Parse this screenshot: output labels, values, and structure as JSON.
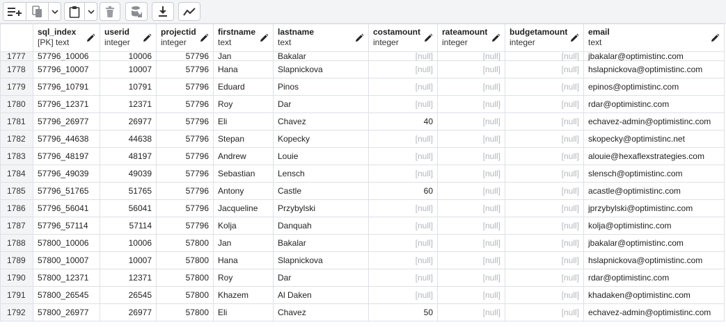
{
  "toolbar": {
    "buttons": [
      {
        "name": "add-row-icon"
      },
      {
        "name": "copy-icon"
      },
      {
        "name": "copy-options-chevron-icon"
      },
      {
        "name": "paste-icon"
      },
      {
        "name": "paste-options-chevron-icon"
      },
      {
        "name": "delete-icon"
      },
      {
        "name": "save-data-icon"
      },
      {
        "name": "download-icon"
      },
      {
        "name": "graph-visualiser-icon"
      }
    ]
  },
  "columns": [
    {
      "name": "sql_index",
      "type": "[PK] text"
    },
    {
      "name": "userid",
      "type": "integer"
    },
    {
      "name": "projectid",
      "type": "integer"
    },
    {
      "name": "firstname",
      "type": "text"
    },
    {
      "name": "lastname",
      "type": "text"
    },
    {
      "name": "costamount",
      "type": "integer"
    },
    {
      "name": "rateamount",
      "type": "integer"
    },
    {
      "name": "budgetamount",
      "type": "integer"
    },
    {
      "name": "email",
      "type": "text"
    }
  ],
  "null_label": "[null]",
  "rows": [
    {
      "rn": "1777",
      "sql_index": "57796_10006",
      "userid": "10006",
      "projectid": "57796",
      "firstname": "Jan",
      "lastname": "Bakalar",
      "costamount": null,
      "rateamount": null,
      "budgetamount": null,
      "email": "jbakalar@optimistinc.com"
    },
    {
      "rn": "1778",
      "sql_index": "57796_10007",
      "userid": "10007",
      "projectid": "57796",
      "firstname": "Hana",
      "lastname": "Slapnickova",
      "costamount": null,
      "rateamount": null,
      "budgetamount": null,
      "email": "hslapnickova@optimistinc.com"
    },
    {
      "rn": "1779",
      "sql_index": "57796_10791",
      "userid": "10791",
      "projectid": "57796",
      "firstname": "Eduard",
      "lastname": "Pinos",
      "costamount": null,
      "rateamount": null,
      "budgetamount": null,
      "email": "epinos@optimistinc.com"
    },
    {
      "rn": "1780",
      "sql_index": "57796_12371",
      "userid": "12371",
      "projectid": "57796",
      "firstname": "Roy",
      "lastname": "Dar",
      "costamount": null,
      "rateamount": null,
      "budgetamount": null,
      "email": "rdar@optimistinc.com"
    },
    {
      "rn": "1781",
      "sql_index": "57796_26977",
      "userid": "26977",
      "projectid": "57796",
      "firstname": "Eli",
      "lastname": "Chavez",
      "costamount": "40",
      "rateamount": null,
      "budgetamount": null,
      "email": "echavez-admin@optimistinc.com"
    },
    {
      "rn": "1782",
      "sql_index": "57796_44638",
      "userid": "44638",
      "projectid": "57796",
      "firstname": "Stepan",
      "lastname": "Kopecky",
      "costamount": null,
      "rateamount": null,
      "budgetamount": null,
      "email": "skopecky@optimistinc.net"
    },
    {
      "rn": "1783",
      "sql_index": "57796_48197",
      "userid": "48197",
      "projectid": "57796",
      "firstname": "Andrew",
      "lastname": "Louie",
      "costamount": null,
      "rateamount": null,
      "budgetamount": null,
      "email": "alouie@hexaflexstrategies.com"
    },
    {
      "rn": "1784",
      "sql_index": "57796_49039",
      "userid": "49039",
      "projectid": "57796",
      "firstname": "Sebastian",
      "lastname": "Lensch",
      "costamount": null,
      "rateamount": null,
      "budgetamount": null,
      "email": "slensch@optimistinc.com"
    },
    {
      "rn": "1785",
      "sql_index": "57796_51765",
      "userid": "51765",
      "projectid": "57796",
      "firstname": "Antony",
      "lastname": "Castle",
      "costamount": "60",
      "rateamount": null,
      "budgetamount": null,
      "email": "acastle@optimistinc.com"
    },
    {
      "rn": "1786",
      "sql_index": "57796_56041",
      "userid": "56041",
      "projectid": "57796",
      "firstname": "Jacqueline",
      "lastname": "Przybylski",
      "costamount": null,
      "rateamount": null,
      "budgetamount": null,
      "email": "jprzybylski@optimistinc.com"
    },
    {
      "rn": "1787",
      "sql_index": "57796_57114",
      "userid": "57114",
      "projectid": "57796",
      "firstname": "Kolja",
      "lastname": "Danquah",
      "costamount": null,
      "rateamount": null,
      "budgetamount": null,
      "email": "kolja@optimistinc.com"
    },
    {
      "rn": "1788",
      "sql_index": "57800_10006",
      "userid": "10006",
      "projectid": "57800",
      "firstname": "Jan",
      "lastname": "Bakalar",
      "costamount": null,
      "rateamount": null,
      "budgetamount": null,
      "email": "jbakalar@optimistinc.com"
    },
    {
      "rn": "1789",
      "sql_index": "57800_10007",
      "userid": "10007",
      "projectid": "57800",
      "firstname": "Hana",
      "lastname": "Slapnickova",
      "costamount": null,
      "rateamount": null,
      "budgetamount": null,
      "email": "hslapnickova@optimistinc.com"
    },
    {
      "rn": "1790",
      "sql_index": "57800_12371",
      "userid": "12371",
      "projectid": "57800",
      "firstname": "Roy",
      "lastname": "Dar",
      "costamount": null,
      "rateamount": null,
      "budgetamount": null,
      "email": "rdar@optimistinc.com"
    },
    {
      "rn": "1791",
      "sql_index": "57800_26545",
      "userid": "26545",
      "projectid": "57800",
      "firstname": "Khazem",
      "lastname": "Al Daken",
      "costamount": null,
      "rateamount": null,
      "budgetamount": null,
      "email": "khadaken@optimistinc.com"
    },
    {
      "rn": "1792",
      "sql_index": "57800_26977",
      "userid": "26977",
      "projectid": "57800",
      "firstname": "Eli",
      "lastname": "Chavez",
      "costamount": "50",
      "rateamount": null,
      "budgetamount": null,
      "email": "echavez-admin@optimistinc.com"
    }
  ]
}
